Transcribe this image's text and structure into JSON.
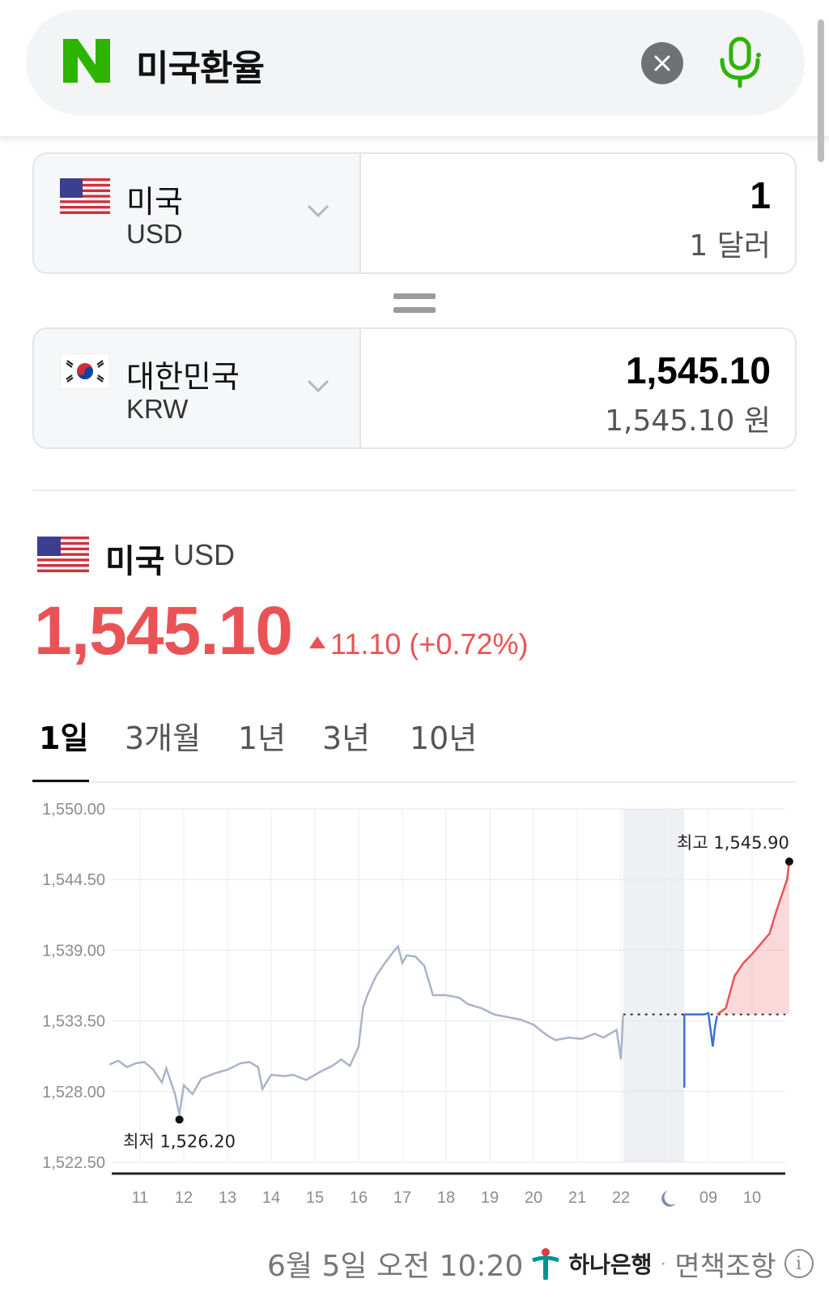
{
  "search": {
    "query": "미국환율"
  },
  "from_currency": {
    "name": "미국",
    "code": "USD",
    "amount": "1",
    "amount_text": "1 달러",
    "flag": "us-flag-icon"
  },
  "to_currency": {
    "name": "대한민국",
    "code": "KRW",
    "amount": "1,545.10",
    "amount_text": "1,545.10 원",
    "flag": "kr-flag-icon"
  },
  "rate": {
    "name": "미국",
    "code": "USD",
    "value": "1,545.10",
    "change": "11.10 (+0.72%)",
    "direction": "up"
  },
  "tabs": [
    {
      "label": "1일",
      "active": true
    },
    {
      "label": "3개월",
      "active": false
    },
    {
      "label": "1년",
      "active": false
    },
    {
      "label": "3년",
      "active": false
    },
    {
      "label": "10년",
      "active": false
    }
  ],
  "colors": {
    "up": "#ea5356",
    "down": "#3d6fd9",
    "history": "#a9b4c9",
    "brand": "#2db400"
  },
  "chart_data": {
    "type": "line",
    "y_ticks": [
      "1,550.00",
      "1,544.50",
      "1,539.00",
      "1,533.50",
      "1,528.00",
      "1,522.50"
    ],
    "ylim": [
      1522.5,
      1550.0
    ],
    "x_ticks": [
      "11",
      "12",
      "13",
      "14",
      "15",
      "16",
      "17",
      "18",
      "19",
      "20",
      "21",
      "22",
      "night-icon",
      "09",
      "10"
    ],
    "high_label": "최고 1,545.90",
    "low_label": "최저 1,526.20",
    "high": 1545.9,
    "low": 1526.2,
    "reference": 1534.0,
    "grid": true,
    "history_points": [
      [
        10.3,
        1530.1
      ],
      [
        10.5,
        1530.4
      ],
      [
        10.7,
        1529.9
      ],
      [
        10.9,
        1530.2
      ],
      [
        11.1,
        1530.3
      ],
      [
        11.3,
        1529.7
      ],
      [
        11.5,
        1528.7
      ],
      [
        11.6,
        1529.8
      ],
      [
        11.8,
        1527.8
      ],
      [
        11.9,
        1526.2
      ],
      [
        12.0,
        1528.5
      ],
      [
        12.2,
        1527.8
      ],
      [
        12.4,
        1529.0
      ],
      [
        12.7,
        1529.4
      ],
      [
        13.0,
        1529.7
      ],
      [
        13.3,
        1530.2
      ],
      [
        13.5,
        1530.3
      ],
      [
        13.7,
        1529.9
      ],
      [
        13.8,
        1528.2
      ],
      [
        14.0,
        1529.3
      ],
      [
        14.3,
        1529.2
      ],
      [
        14.5,
        1529.3
      ],
      [
        14.8,
        1528.9
      ],
      [
        15.1,
        1529.5
      ],
      [
        15.4,
        1530.0
      ],
      [
        15.6,
        1530.5
      ],
      [
        15.8,
        1530.0
      ],
      [
        16.0,
        1531.5
      ],
      [
        16.1,
        1534.5
      ],
      [
        16.2,
        1535.5
      ],
      [
        16.4,
        1537.0
      ],
      [
        16.6,
        1538.0
      ],
      [
        16.8,
        1538.9
      ],
      [
        16.9,
        1539.3
      ],
      [
        17.0,
        1538.0
      ],
      [
        17.1,
        1538.6
      ],
      [
        17.3,
        1538.5
      ],
      [
        17.5,
        1537.8
      ],
      [
        17.7,
        1535.5
      ],
      [
        18.0,
        1535.5
      ],
      [
        18.3,
        1535.3
      ],
      [
        18.5,
        1534.8
      ],
      [
        18.8,
        1534.5
      ],
      [
        19.1,
        1534.0
      ],
      [
        19.4,
        1533.8
      ],
      [
        19.7,
        1533.6
      ],
      [
        20.0,
        1533.2
      ],
      [
        20.3,
        1532.4
      ],
      [
        20.5,
        1532.0
      ],
      [
        20.8,
        1532.2
      ],
      [
        21.1,
        1532.1
      ],
      [
        21.4,
        1532.5
      ],
      [
        21.6,
        1532.2
      ],
      [
        21.9,
        1532.8
      ],
      [
        22.0,
        1530.5
      ],
      [
        22.05,
        1534.0
      ]
    ],
    "today_down_points": [
      [
        23.45,
        1534.0
      ],
      [
        23.5,
        1534.0
      ],
      [
        23.9,
        1534.0
      ],
      [
        24.0,
        1534.1
      ],
      [
        24.1,
        1531.5
      ],
      [
        24.15,
        1533.0
      ],
      [
        24.2,
        1533.9
      ]
    ],
    "today_up_points": [
      [
        24.2,
        1534.0
      ],
      [
        24.4,
        1534.5
      ],
      [
        24.6,
        1537.0
      ],
      [
        24.8,
        1538.0
      ],
      [
        25.0,
        1538.7
      ],
      [
        25.2,
        1539.5
      ],
      [
        25.4,
        1540.3
      ],
      [
        25.55,
        1542.0
      ],
      [
        25.7,
        1543.5
      ],
      [
        25.8,
        1544.5
      ],
      [
        25.85,
        1545.9
      ]
    ]
  },
  "footer": {
    "date": "6월 5일 오전 10:20",
    "bank": "하나은행",
    "separator": "·",
    "disclaimer": "면책조항",
    "info_icon": "info-icon"
  }
}
